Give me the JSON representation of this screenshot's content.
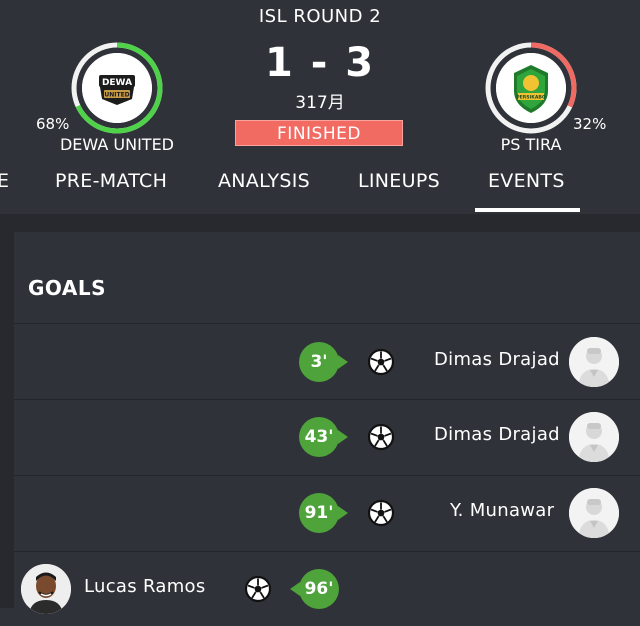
{
  "match": {
    "round": "ISL ROUND 2",
    "score": "1 - 3",
    "date": "317月",
    "status": "FINISHED"
  },
  "home": {
    "name": "DEWA UNITED",
    "pct_label": "68%",
    "pct": 0.68,
    "logo_text_top": "DEWA",
    "logo_text_bottom": "UNITED"
  },
  "away": {
    "name": "PS TIRA",
    "pct_label": "32%",
    "pct": 0.32,
    "logo_text": "PERSIKABO"
  },
  "tabs": [
    {
      "label": "E"
    },
    {
      "label": "PRE-MATCH"
    },
    {
      "label": "ANALYSIS"
    },
    {
      "label": "LINEUPS"
    },
    {
      "label": "EVENTS",
      "active": true
    }
  ],
  "goals": {
    "title": "GOALS",
    "events": [
      {
        "minute": "3'",
        "player": "Dimas Drajad",
        "side": "away"
      },
      {
        "minute": "43'",
        "player": "Dimas Drajad",
        "side": "away"
      },
      {
        "minute": "91'",
        "player": "Y. Munawar",
        "side": "away"
      },
      {
        "minute": "96'",
        "player": "Lucas Ramos",
        "side": "home"
      }
    ]
  },
  "colors": {
    "ring_home": "#4fd24a",
    "ring_away": "#ef6a63",
    "ring_track": "#f2f2f2",
    "badge_green": "#4ea33a",
    "status_red": "#f26b63"
  }
}
